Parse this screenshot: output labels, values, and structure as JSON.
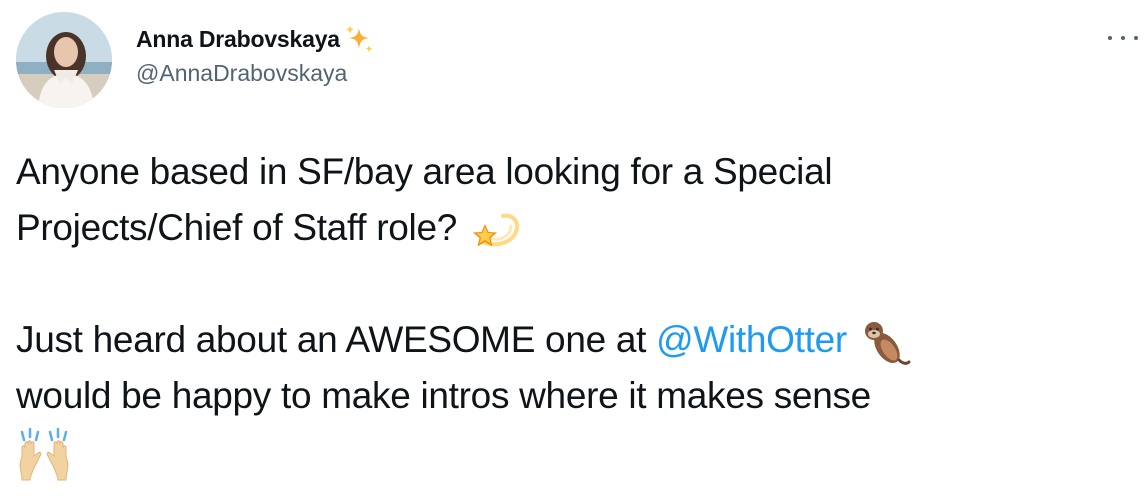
{
  "author": {
    "display_name": "Anna Drabovskaya",
    "name_emoji": "sparkles-icon",
    "handle": "@AnnaDrabovskaya"
  },
  "tweet": {
    "line1": "Anyone based in SF/bay area looking for a Special",
    "line2": "Projects/Chief of Staff role?",
    "line2_emoji": "dizzy-star-icon",
    "line3_before": "Just heard about an AWESOME one at ",
    "mention": "@WithOtter",
    "line3_emoji": "otter-icon",
    "line4": "would be happy to make intros where it makes sense",
    "line5_emoji": "raising-hands-icon"
  },
  "colors": {
    "text": "#0f1419",
    "secondary": "#536471",
    "link": "#1d9bf0"
  }
}
